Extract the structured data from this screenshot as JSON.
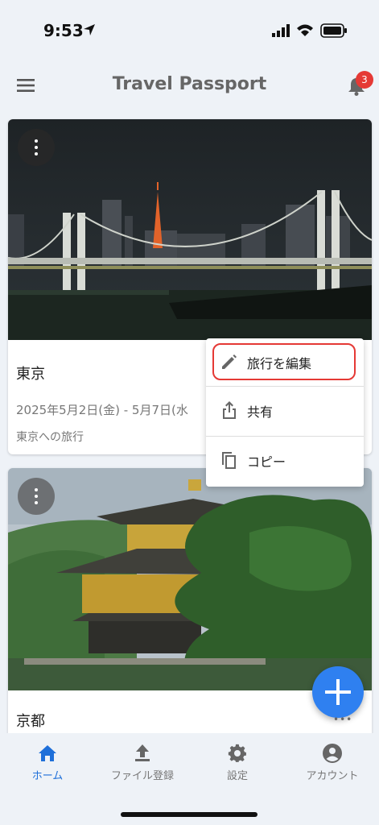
{
  "status_bar": {
    "time": "9:53"
  },
  "app_bar": {
    "title": "Travel Passport",
    "notification_count": "3"
  },
  "trips": [
    {
      "title": "東京",
      "dates": "2025年5月2日(金) - 5月7日(水",
      "description": "東京への旅行",
      "image": "rainbow-bridge-night"
    },
    {
      "title": "京都",
      "image": "kinkakuji-golden-pavilion"
    }
  ],
  "context_menu": {
    "items": [
      {
        "label": "旅行を編集",
        "icon": "pencil-icon",
        "highlighted": true
      },
      {
        "label": "共有",
        "icon": "share-icon"
      },
      {
        "label": "コピー",
        "icon": "copy-icon"
      }
    ]
  },
  "fab": {
    "icon": "plus-icon"
  },
  "bottom_nav": {
    "items": [
      {
        "label": "ホーム",
        "icon": "home-icon",
        "active": true
      },
      {
        "label": "ファイル登録",
        "icon": "upload-icon"
      },
      {
        "label": "設定",
        "icon": "gear-icon"
      },
      {
        "label": "アカウント",
        "icon": "account-icon"
      }
    ]
  },
  "colors": {
    "accent": "#2f80f0",
    "active_nav": "#1e6fd9",
    "badge": "#e53935",
    "highlight": "#e53935"
  }
}
